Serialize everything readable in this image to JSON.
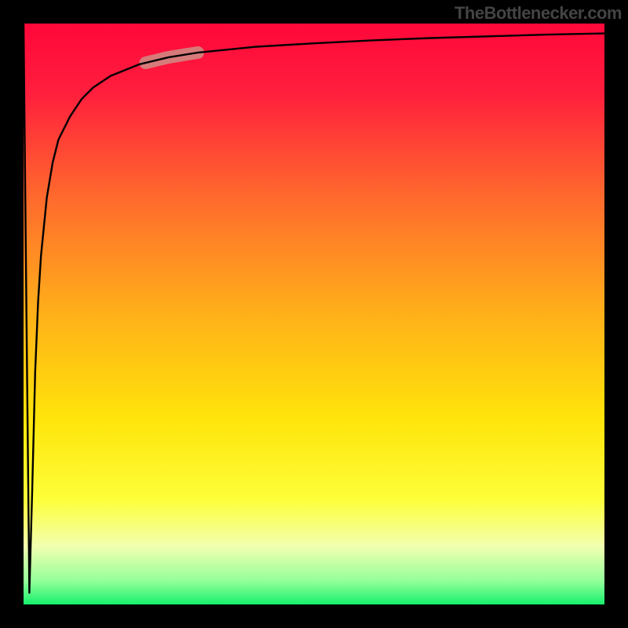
{
  "chart_data": {
    "type": "line",
    "title": "",
    "xlabel": "",
    "ylabel": "",
    "xlim": [
      0,
      100
    ],
    "ylim": [
      0,
      100
    ],
    "x": [
      0,
      0.5,
      1,
      1.5,
      2,
      2.5,
      3,
      4,
      5,
      6,
      8,
      10,
      12,
      15,
      20,
      25,
      30,
      40,
      50,
      60,
      70,
      80,
      90,
      100
    ],
    "values": [
      100,
      50,
      2,
      20,
      40,
      52,
      60,
      70,
      76,
      80,
      84,
      87,
      89,
      91,
      93,
      94.2,
      95,
      96,
      96.6,
      97.1,
      97.5,
      97.8,
      98.1,
      98.3
    ],
    "highlight_range_x": [
      21,
      30
    ],
    "annotations": [],
    "legend": []
  },
  "gradient": {
    "stops": [
      {
        "pos": 0.0,
        "color": "#ff073a"
      },
      {
        "pos": 0.12,
        "color": "#ff1f3d"
      },
      {
        "pos": 0.3,
        "color": "#ff6a2d"
      },
      {
        "pos": 0.5,
        "color": "#ffb019"
      },
      {
        "pos": 0.68,
        "color": "#ffe40a"
      },
      {
        "pos": 0.82,
        "color": "#fdff3a"
      },
      {
        "pos": 0.9,
        "color": "#f2ffb0"
      },
      {
        "pos": 0.96,
        "color": "#93ff9a"
      },
      {
        "pos": 1.0,
        "color": "#16f06c"
      }
    ]
  },
  "watermark": {
    "text": "TheBottlenecker.com"
  },
  "style": {
    "curve_color": "#000000",
    "curve_width": 2.4,
    "highlight_color": "#cf8d86",
    "highlight_width": 16,
    "highlight_opacity": 0.85
  }
}
